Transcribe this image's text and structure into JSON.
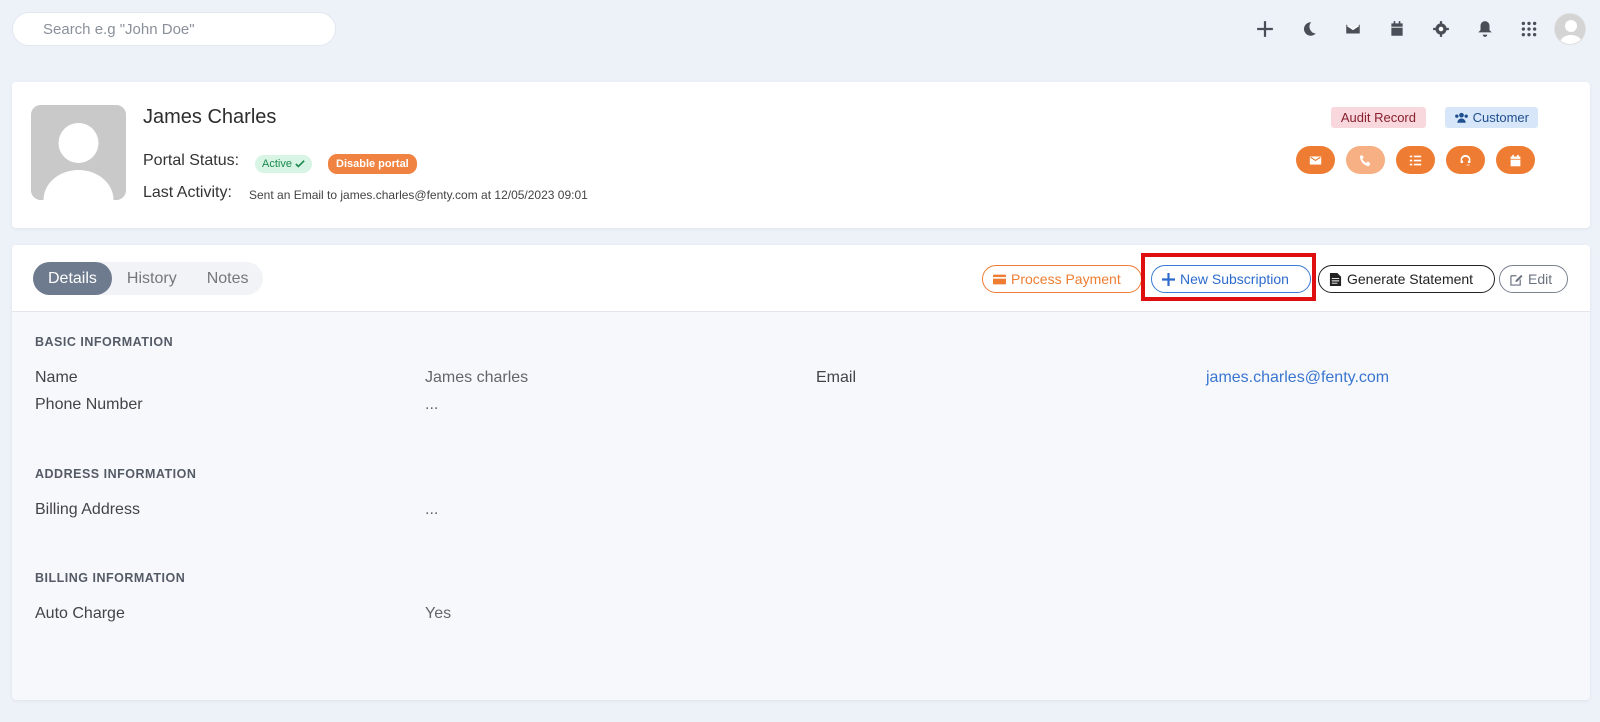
{
  "search": {
    "placeholder": "Search e.g \"John Doe\""
  },
  "topbar": {
    "icons": [
      "plus-icon",
      "moon-icon",
      "mail-icon",
      "calendar-icon",
      "gear-icon",
      "bell-icon",
      "grid-icon",
      "user-avatar"
    ]
  },
  "profile": {
    "name": "James Charles",
    "portal_status_label": "Portal Status:",
    "active_badge": "Active",
    "disable_button": "Disable portal",
    "last_activity_label": "Last Activity:",
    "last_activity_text": "Sent an Email to james.charles@fenty.com at 12/05/2023 09:01",
    "audit_badge": "Audit Record",
    "customer_badge": "Customer",
    "action_icons": [
      "email-icon",
      "phone-icon",
      "tasks-icon",
      "support-icon",
      "calendar-icon"
    ]
  },
  "details": {
    "tabs": [
      {
        "label": "Details",
        "active": true
      },
      {
        "label": "History",
        "active": false
      },
      {
        "label": "Notes",
        "active": false
      }
    ],
    "buttons": {
      "process_payment": "Process Payment",
      "new_subscription": "New Subscription",
      "generate_statement": "Generate Statement",
      "edit": "Edit"
    },
    "basic": {
      "heading": "BASIC INFORMATION",
      "name_label": "Name",
      "name_value": "James charles",
      "email_label": "Email",
      "email_value": "james.charles@fenty.com",
      "phone_label": "Phone Number",
      "phone_value": "..."
    },
    "address": {
      "heading": "ADDRESS INFORMATION",
      "billing_label": "Billing Address",
      "billing_value": "..."
    },
    "billing": {
      "heading": "BILLING INFORMATION",
      "auto_charge_label": "Auto Charge",
      "auto_charge_value": "Yes"
    }
  },
  "colors": {
    "accent_orange": "#ee7d33",
    "accent_blue": "#3b7ad6",
    "highlight_red": "#e00f0f"
  }
}
